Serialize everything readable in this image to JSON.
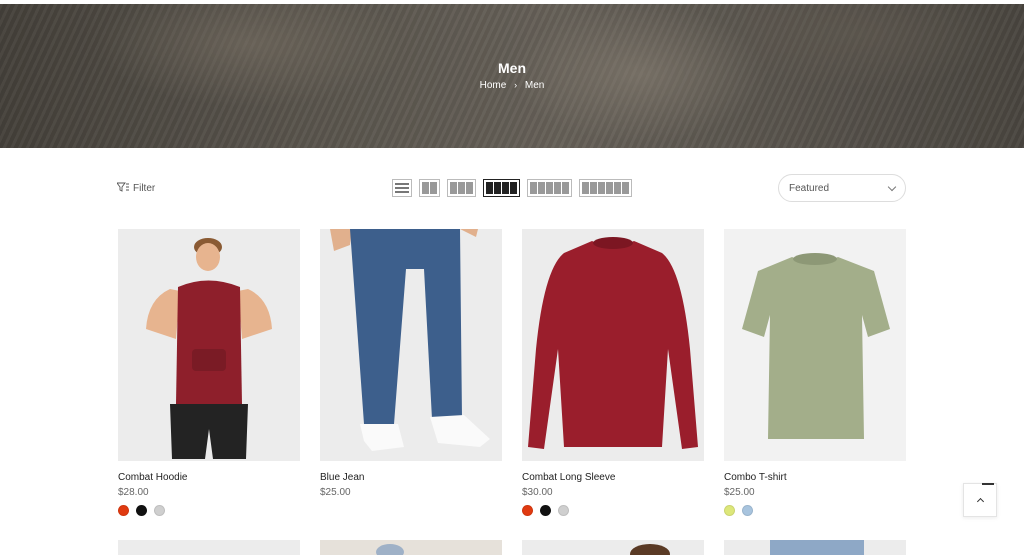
{
  "hero": {
    "title": "Men"
  },
  "breadcrumb": {
    "home": "Home",
    "separator": "›",
    "current": "Men"
  },
  "toolbar": {
    "filter_label": "Filter",
    "sort_selected": "Featured",
    "layouts": [
      "list",
      "2-columns",
      "3-columns",
      "4-columns",
      "5-columns",
      "6-columns"
    ],
    "active_layout": "4-columns"
  },
  "products": [
    {
      "name": "Combat Hoodie",
      "price": "$28.00",
      "swatches": [
        "#e03a10",
        "#111111",
        "#cfcfcf"
      ]
    },
    {
      "name": "Blue Jean",
      "price": "$25.00",
      "swatches": []
    },
    {
      "name": "Combat Long Sleeve",
      "price": "$30.00",
      "swatches": [
        "#e03a10",
        "#111111",
        "#cfcfcf"
      ]
    },
    {
      "name": "Combo T-shirt",
      "price": "$25.00",
      "swatches": [
        "#dde77a",
        "#a8c4de"
      ]
    }
  ],
  "colors": {
    "hoodie": "#8e1f2b",
    "shorts": "#232323",
    "denim": "#3d5f8c",
    "longsleeve": "#9a1e2c",
    "tshirt": "#a3ae8a"
  },
  "icons": {
    "filter": "filter-icon",
    "sort": "chevron-down-icon",
    "back_to_top": "chevron-up-icon"
  }
}
